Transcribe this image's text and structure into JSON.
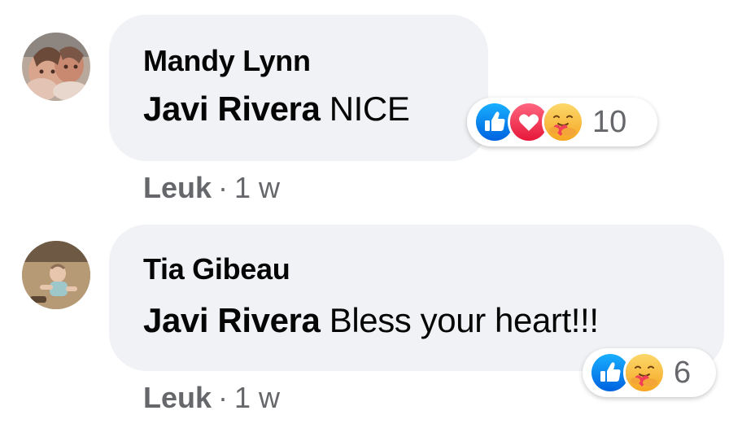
{
  "comments": [
    {
      "author": "Mandy Lynn",
      "mention": "Javi Rivera",
      "text": " NICE",
      "reactions": {
        "icons": [
          "like-icon",
          "love-icon",
          "care-icon"
        ],
        "count": "10"
      },
      "like_label": "Leuk",
      "separator": "·",
      "time": "1 w"
    },
    {
      "author": "Tia Gibeau",
      "mention": "Javi Rivera",
      "text": " Bless your heart!!!",
      "reactions": {
        "icons": [
          "like-icon",
          "care-icon"
        ],
        "count": "6"
      },
      "like_label": "Leuk",
      "separator": "·",
      "time": "1 w"
    }
  ],
  "colors": {
    "bubble": "#f0f2f5",
    "like_blue": "#1877f2",
    "love_red": "#f33e58",
    "care_yellow": "#f7b125",
    "meta_gray": "#65676b",
    "text": "#050505"
  }
}
